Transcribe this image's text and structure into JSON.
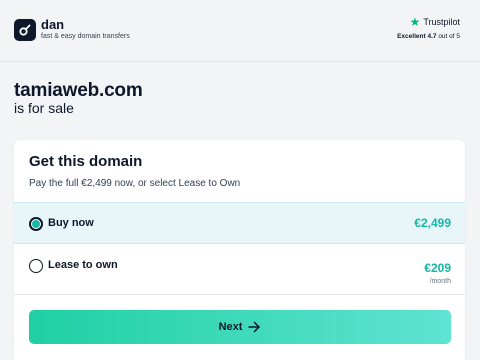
{
  "header": {
    "brand": "dan",
    "tagline": "fast & easy domain transfers",
    "trustpilot": {
      "name": "Trustpilot",
      "rating_label": "Excellent",
      "score": "4.7",
      "scale": "out of 5"
    }
  },
  "hero": {
    "domain": "tamiaweb.com",
    "subtitle": "is for sale"
  },
  "card": {
    "title": "Get this domain",
    "subtitle": "Pay the full €2,499 now, or select Lease to Own",
    "options": [
      {
        "label": "Buy now",
        "price": "€2,499",
        "selected": true
      },
      {
        "label": "Lease to own",
        "price": "€209",
        "unit": "/month",
        "selected": false
      }
    ],
    "next_label": "Next"
  },
  "colors": {
    "accent": "#14b8a6",
    "selected_bg": "#e8f6f9",
    "trustpilot_green": "#00b67a"
  }
}
